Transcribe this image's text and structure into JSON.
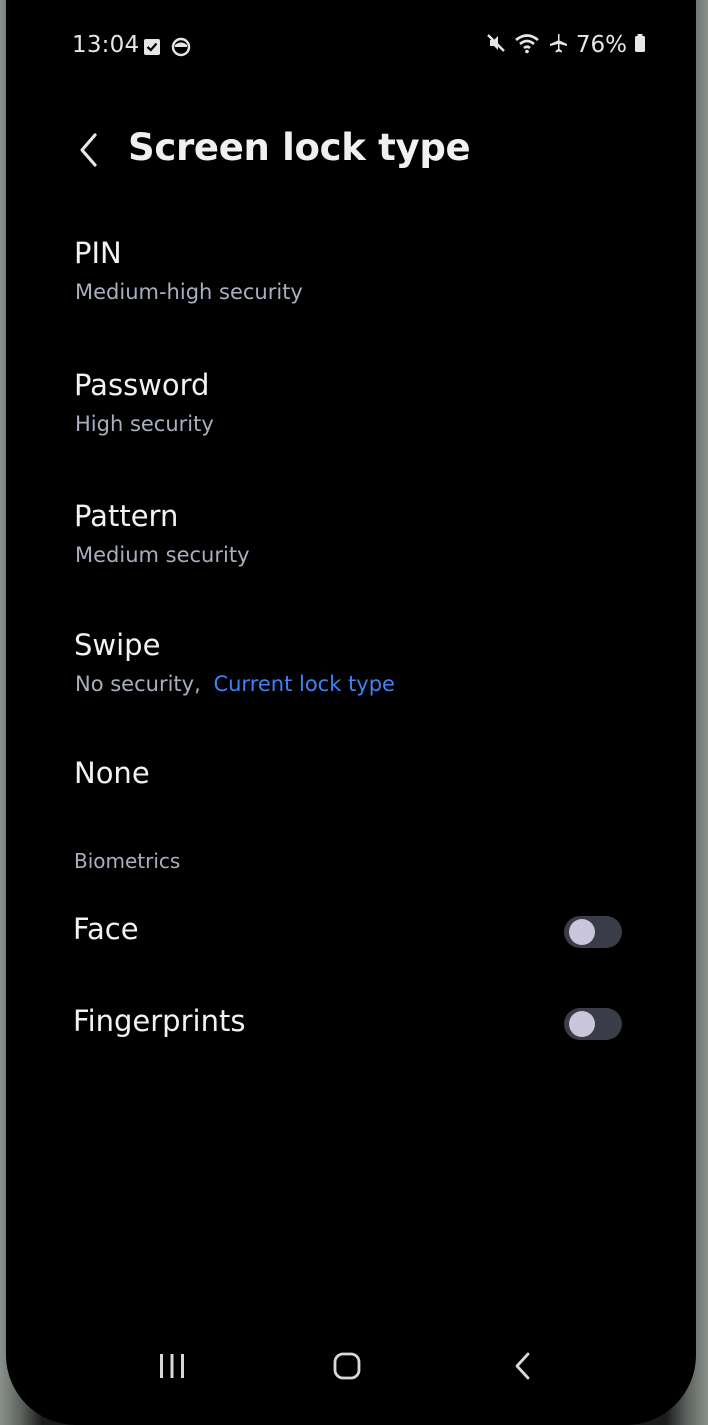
{
  "status_bar": {
    "time": "13:04",
    "battery": "76%",
    "icons": [
      "checkbox-notification-icon",
      "circle-notification-icon",
      "mute-icon",
      "wifi-icon",
      "airplane-icon",
      "battery-icon"
    ]
  },
  "header": {
    "title": "Screen lock type",
    "back_icon": "back-chevron-icon"
  },
  "options": [
    {
      "title": "PIN",
      "subtitle": "Medium-high security"
    },
    {
      "title": "Password",
      "subtitle": "High security"
    },
    {
      "title": "Pattern",
      "subtitle": "Medium security"
    },
    {
      "title": "Swipe",
      "subtitle": "No security,",
      "current_label": "Current lock type"
    },
    {
      "title": "None"
    }
  ],
  "biometrics": {
    "section_title": "Biometrics",
    "items": [
      {
        "label": "Face",
        "enabled": false
      },
      {
        "label": "Fingerprints",
        "enabled": false
      }
    ]
  },
  "nav_bar": {
    "icons": [
      "recents-icon",
      "home-icon",
      "back-icon"
    ]
  },
  "colors": {
    "background": "#000000",
    "accent": "#3e82f5",
    "secondary_text": "#a9aebf",
    "toggle_off_track": "#3a3c47",
    "toggle_off_knob": "#c9c6dc"
  }
}
